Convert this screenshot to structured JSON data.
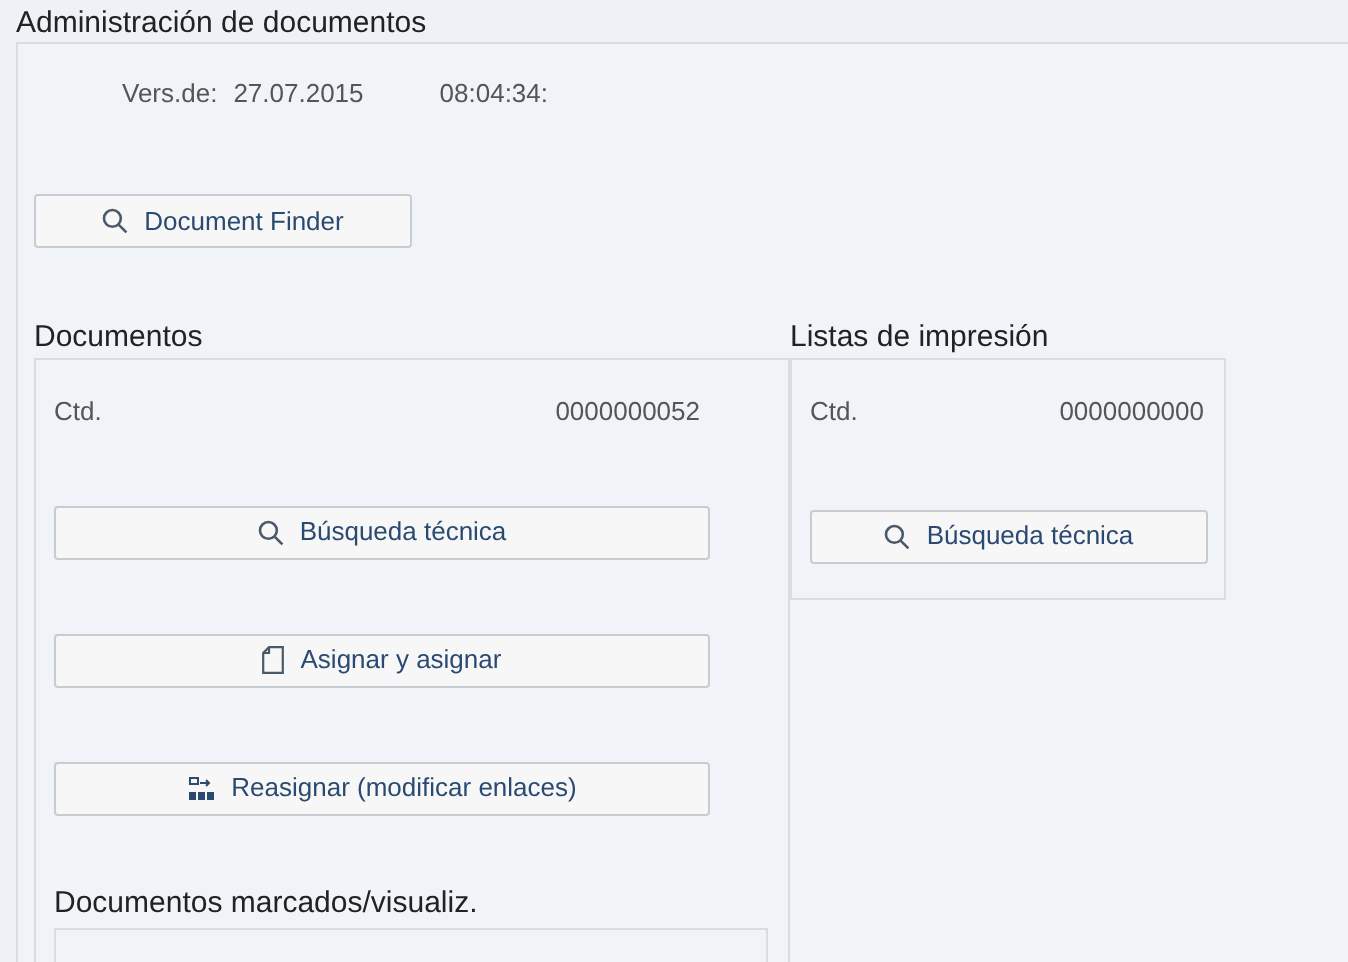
{
  "window": {
    "title": "Administración de documentos"
  },
  "version": {
    "label": "Vers.de:",
    "date": "27.07.2015",
    "time": "08:04:34:"
  },
  "finder_button": {
    "label": "Document Finder",
    "kind": "search"
  },
  "documents": {
    "title": "Documentos",
    "count_label": "Ctd.",
    "count": "0000000052",
    "buttons": [
      {
        "label": "Búsqueda técnica",
        "kind": "search"
      },
      {
        "label": "Asignar y asignar",
        "kind": "document"
      },
      {
        "label": "Reasignar (modificar enlaces)",
        "kind": "reassign"
      }
    ],
    "marked_title": "Documentos marcados/visualiz."
  },
  "print_lists": {
    "title": "Listas de impresión",
    "count_label": "Ctd.",
    "count": "0000000000",
    "buttons": [
      {
        "label": "Búsqueda técnica",
        "kind": "search"
      }
    ]
  }
}
